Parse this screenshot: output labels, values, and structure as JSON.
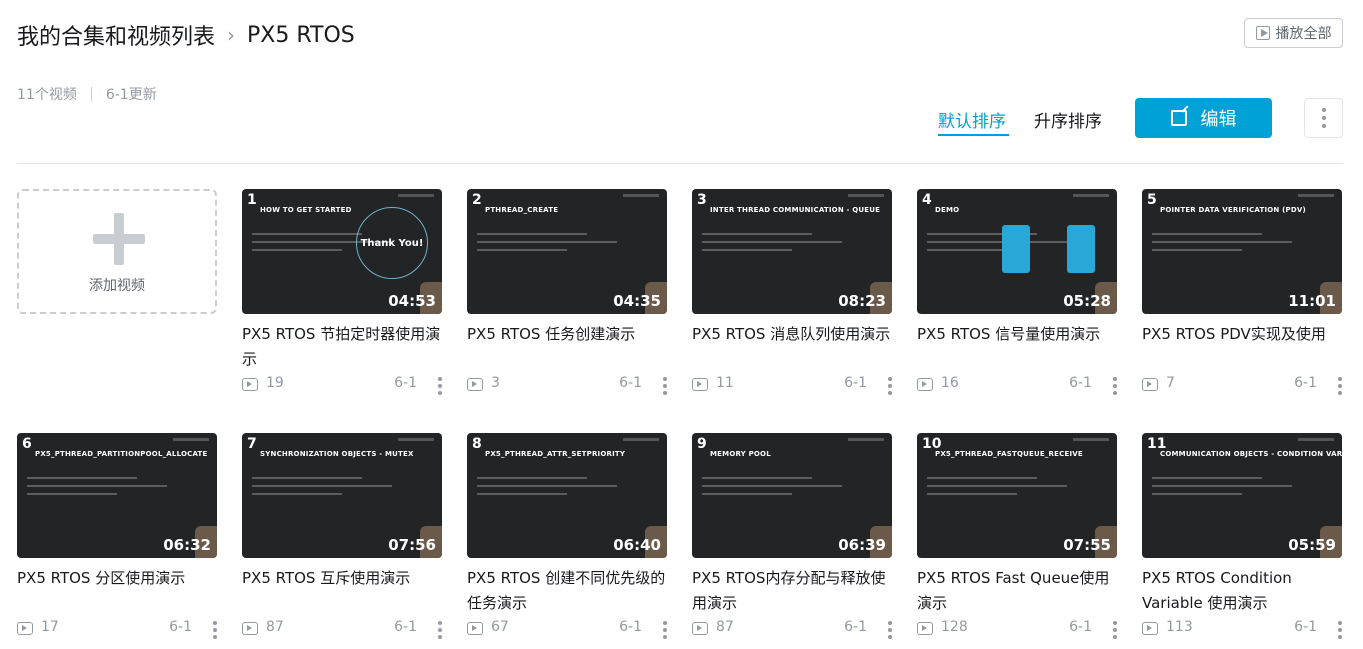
{
  "breadcrumb": {
    "parent": "我的合集和视频列表",
    "separator": "›",
    "current": "PX5 RTOS"
  },
  "play_all": {
    "label": "播放全部",
    "icon": "play-square-icon"
  },
  "meta": {
    "video_count": "11个视频",
    "updated": "6-1更新"
  },
  "sort": {
    "default_label": "默认排序",
    "asc_label": "升序排序"
  },
  "edit_button": {
    "label": "编辑",
    "icon": "edit-icon"
  },
  "add_video": {
    "label": "添加视频"
  },
  "colors": {
    "accent": "#00a1d6",
    "text": "#18191c",
    "muted": "#9499a0"
  },
  "videos": [
    {
      "num": "1",
      "heading": "HOW TO GET STARTED",
      "duration": "04:53",
      "title": "PX5 RTOS 节拍定时器使用演示",
      "views": "19",
      "date": "6-1"
    },
    {
      "num": "2",
      "heading": "PTHREAD_CREATE",
      "duration": "04:35",
      "title": "PX5 RTOS 任务创建演示",
      "views": "3",
      "date": "6-1"
    },
    {
      "num": "3",
      "heading": "INTER THREAD COMMUNICATION - QUEUE",
      "duration": "08:23",
      "title": "PX5 RTOS 消息队列使用演示",
      "views": "11",
      "date": "6-1"
    },
    {
      "num": "4",
      "heading": "DEMO",
      "duration": "05:28",
      "title": "PX5 RTOS 信号量使用演示",
      "views": "16",
      "date": "6-1"
    },
    {
      "num": "5",
      "heading": "POINTER DATA VERIFICATION (PDV)",
      "duration": "11:01",
      "title": "PX5 RTOS PDV实现及使用",
      "views": "7",
      "date": "6-1"
    },
    {
      "num": "6",
      "heading": "PX5_PTHREAD_PARTITIONPOOL_ALLOCATE",
      "duration": "06:32",
      "title": "PX5 RTOS 分区使用演示",
      "views": "17",
      "date": "6-1"
    },
    {
      "num": "7",
      "heading": "SYNCHRONIZATION OBJECTS - MUTEX",
      "duration": "07:56",
      "title": "PX5 RTOS 互斥使用演示",
      "views": "87",
      "date": "6-1"
    },
    {
      "num": "8",
      "heading": "PX5_PTHREAD_ATTR_SETPRIORITY",
      "duration": "06:40",
      "title": "PX5 RTOS 创建不同优先级的任务演示",
      "views": "67",
      "date": "6-1"
    },
    {
      "num": "9",
      "heading": "MEMORY POOL",
      "duration": "06:39",
      "title": "PX5 RTOS内存分配与释放使用演示",
      "views": "87",
      "date": "6-1"
    },
    {
      "num": "10",
      "heading": "PX5_PTHREAD_FASTQUEUE_RECEIVE",
      "duration": "07:55",
      "title": "PX5 RTOS Fast Queue使用演示",
      "views": "128",
      "date": "6-1"
    },
    {
      "num": "11",
      "heading": "COMMUNICATION OBJECTS - CONDITION VARIABLE",
      "duration": "05:59",
      "title": "PX5 RTOS Condition Variable 使用演示",
      "views": "113",
      "date": "6-1"
    }
  ]
}
